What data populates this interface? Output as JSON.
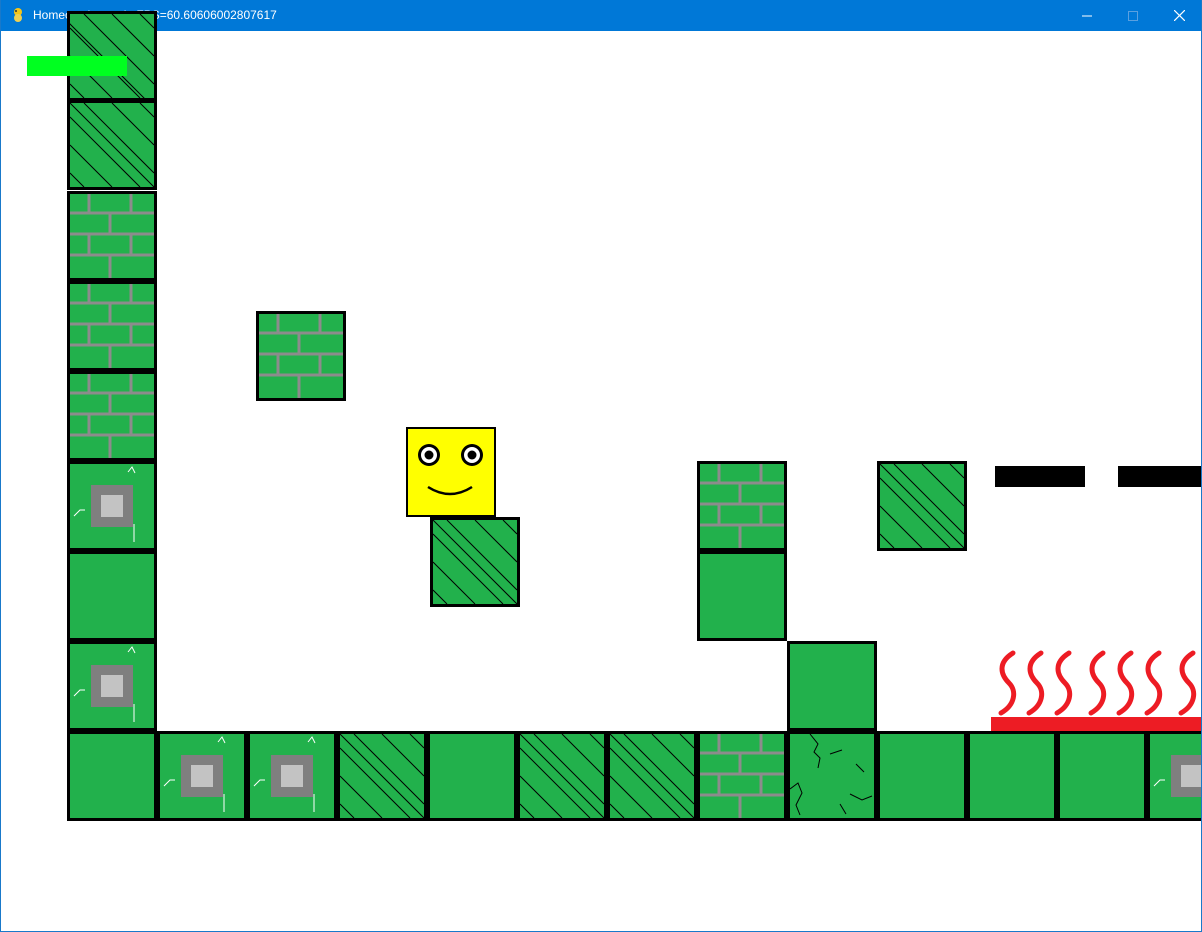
{
  "window": {
    "title": "Homecoming main FPS=60.60606002807617",
    "buttons": {
      "minimize": "minimize",
      "maximize": "maximize",
      "close": "close"
    }
  },
  "colors": {
    "titlebar": "#0078d7",
    "tile_green": "#22b14c",
    "tile_border": "#000000",
    "mortar_gray": "#8c8c8c",
    "stone_outer": "#7f7f7f",
    "stone_inner": "#c3c3c3",
    "health_green": "#00ff20",
    "lava_red": "#ed1c24",
    "player_yellow": "#ffff00"
  },
  "hud": {
    "health_fraction": 1.0
  },
  "player": {
    "name": "yellow square character",
    "expression": "smile"
  },
  "tile_types": [
    "plain",
    "hatched",
    "brick",
    "stone",
    "cracked"
  ],
  "icons": {
    "minimize": "minimize-icon",
    "maximize": "maximize-icon",
    "close": "close-icon",
    "app": "python-icon",
    "hazard": "flame-icon"
  }
}
